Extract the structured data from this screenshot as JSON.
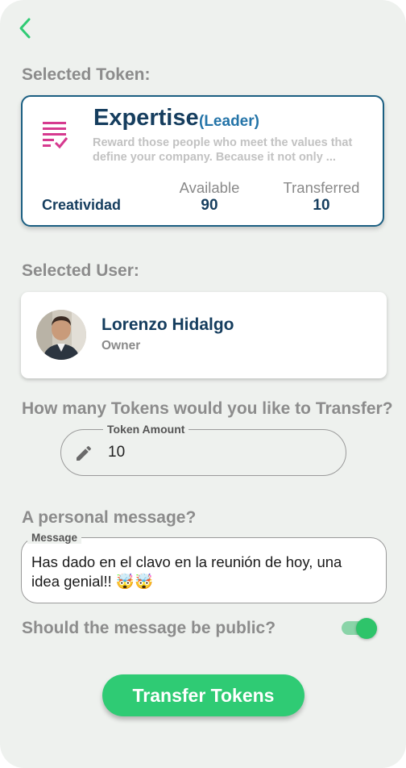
{
  "nav": {
    "back_icon": "chevron-left-icon"
  },
  "token_section": {
    "label": "Selected Token:",
    "card": {
      "icon": "list-check-icon",
      "name": "Expertise",
      "role": "(Leader)",
      "description": "Reward those people who meet the values that define your company. Because it not only ...",
      "category": "Creatividad",
      "available_label": "Available",
      "available_value": "90",
      "transferred_label": "Transferred",
      "transferred_value": "10"
    }
  },
  "user_section": {
    "label": "Selected User:",
    "card": {
      "name": "Lorenzo Hidalgo",
      "role": "Owner"
    }
  },
  "amount_section": {
    "question": "How many Tokens would you like to Transfer?",
    "field_label": "Token Amount",
    "value": "10",
    "icon": "pencil-icon"
  },
  "message_section": {
    "question": "A personal message?",
    "field_label": "Message",
    "value": "Has dado en el clavo en la reunión de hoy, una idea genial!! 🤯🤯"
  },
  "public_section": {
    "question": "Should the message be public?",
    "toggle_on": true
  },
  "action": {
    "transfer_label": "Transfer Tokens"
  },
  "colors": {
    "accent_green": "#2fcb74",
    "navy": "#153d5e",
    "link_blue": "#2474a8",
    "icon_pink": "#d63a8f",
    "background": "#eef1ee"
  }
}
